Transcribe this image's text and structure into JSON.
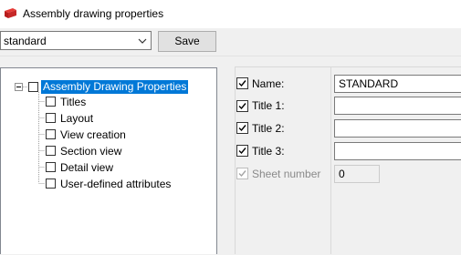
{
  "window": {
    "title": "Assembly drawing properties"
  },
  "toolbar": {
    "preset_value": "standard",
    "save_label": "Save"
  },
  "tree": {
    "root": {
      "label": "Assembly Drawing Properties",
      "checked": false,
      "expanded": true,
      "selected": true
    },
    "children": [
      {
        "label": "Titles"
      },
      {
        "label": "Layout"
      },
      {
        "label": "View creation"
      },
      {
        "label": "Section view"
      },
      {
        "label": "Detail view"
      },
      {
        "label": "User-defined attributes"
      }
    ]
  },
  "fields": {
    "name": {
      "label": "Name:",
      "value": "STANDARD",
      "checked": true
    },
    "title1": {
      "label": "Title 1:",
      "value": "",
      "checked": true
    },
    "title2": {
      "label": "Title 2:",
      "value": "",
      "checked": true
    },
    "title3": {
      "label": "Title 3:",
      "value": "",
      "checked": true
    },
    "sheet_number": {
      "label": "Sheet number",
      "value": "0",
      "checked": true,
      "enabled": false
    }
  },
  "colors": {
    "selection": "#0078d7",
    "app_icon": "#d32f2f"
  }
}
